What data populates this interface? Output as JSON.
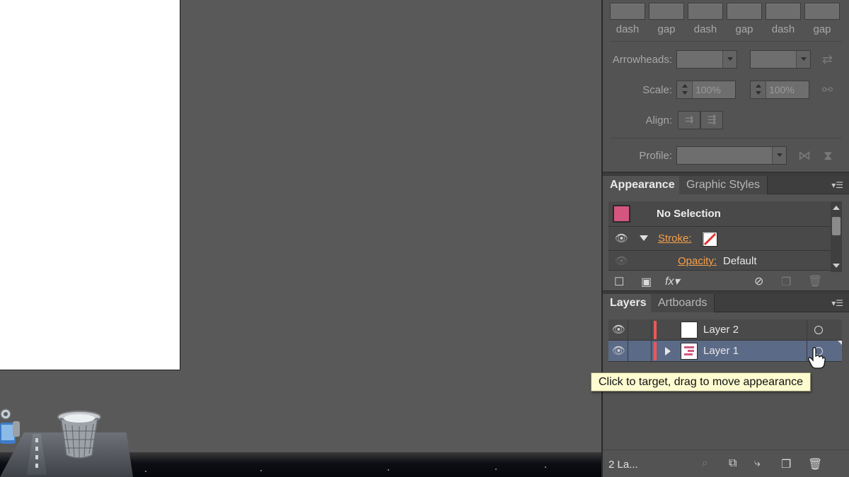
{
  "stroke_panel": {
    "dash_gap_labels": [
      "dash",
      "gap",
      "dash",
      "gap",
      "dash",
      "gap"
    ],
    "arrowheads_label": "Arrowheads:",
    "scale_label": "Scale:",
    "scale_start": "100%",
    "scale_end": "100%",
    "align_label": "Align:",
    "profile_label": "Profile:"
  },
  "appearance_panel": {
    "tabs": [
      "Appearance",
      "Graphic Styles"
    ],
    "selection_title": "No Selection",
    "stroke_label": "Stroke:",
    "opacity_label": "Opacity:",
    "opacity_value": "Default",
    "fill_swatch_color": "#d4567e"
  },
  "layers_panel": {
    "tabs": [
      "Layers",
      "Artboards"
    ],
    "layers": [
      {
        "name": "Layer 2",
        "selected": false,
        "color": "#ea5858"
      },
      {
        "name": "Layer 1",
        "selected": true,
        "color": "#ea5858"
      }
    ],
    "count_label": "2 La...",
    "tooltip": "Click to target, drag to move appearance"
  }
}
